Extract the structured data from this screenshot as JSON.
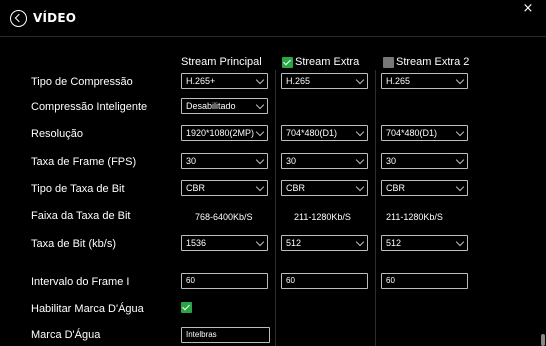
{
  "header": {
    "title": "VÍDEO"
  },
  "icons": {
    "back": "back-arrow-circle-icon",
    "close": "close-icon",
    "check": "checkbox-checked-icon"
  },
  "close_glyph": "×",
  "colors": {
    "background": "#000000",
    "checkbox_on": "#29a744",
    "checkbox_off": "#777777",
    "text": "#ffffff"
  },
  "columns": {
    "main": {
      "label": "Stream Principal",
      "checkbox": null
    },
    "extra": {
      "label": "Stream Extra",
      "checked": true
    },
    "extra2": {
      "label": "Stream Extra 2",
      "checked": false
    }
  },
  "rows": {
    "compression_type": {
      "label": "Tipo de Compressão",
      "main": "H.265+",
      "extra": "H.265",
      "extra2": "H.265"
    },
    "smart_compression": {
      "label": "Compressão Inteligente",
      "main": "Desabilitado"
    },
    "resolution": {
      "label": "Resolução",
      "main": "1920*1080(2MP)",
      "extra": "704*480(D1)",
      "extra2": "704*480(D1)"
    },
    "frame_rate": {
      "label": "Taxa de Frame (FPS)",
      "main": "30",
      "extra": "30",
      "extra2": "30"
    },
    "bitrate_type": {
      "label": "Tipo de Taxa de Bit",
      "main": "CBR",
      "extra": "CBR",
      "extra2": "CBR"
    },
    "bitrate_range": {
      "label": "Faixa da Taxa de Bit",
      "main": "768-6400Kb/S",
      "extra": "211-1280Kb/S",
      "extra2": "211-1280Kb/S"
    },
    "bitrate": {
      "label": "Taxa de Bit (kb/s)",
      "main": "1536",
      "extra": "512",
      "extra2": "512"
    },
    "i_frame_interval": {
      "label": "Intervalo do Frame I",
      "main": "60",
      "extra": "60",
      "extra2": "60"
    },
    "enable_watermark": {
      "label": "Habilitar Marca D'Água",
      "checked": true
    },
    "watermark": {
      "label": "Marca D'Água",
      "value": "Intelbras"
    }
  }
}
